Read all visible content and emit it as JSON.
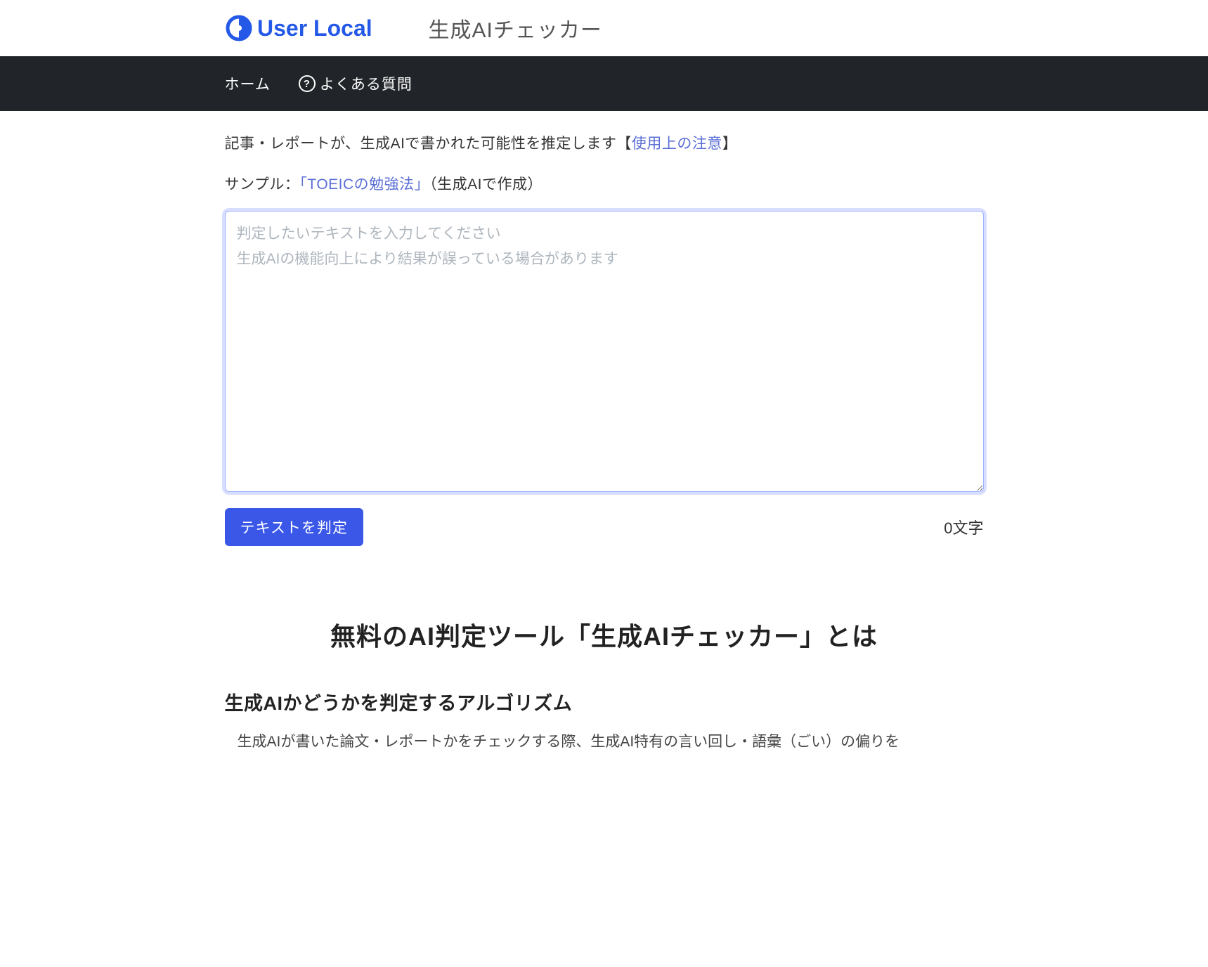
{
  "header": {
    "logo_text": "User Local",
    "app_title": "生成AIチェッカー"
  },
  "nav": {
    "home": "ホーム",
    "faq": "よくある質問"
  },
  "intro": {
    "prefix": "記事・レポートが、生成AIで書かれた可能性を推定します【",
    "notice_link": "使用上の注意",
    "suffix": "】"
  },
  "sample": {
    "label": "サンプル：",
    "link": "「TOEICの勉強法」",
    "note": "（生成AIで作成）"
  },
  "input": {
    "placeholder": "判定したいテキストを入力してください\n生成AIの機能向上により結果が誤っている場合があります",
    "value": ""
  },
  "actions": {
    "submit_label": "テキストを判定",
    "char_count": "0文字"
  },
  "section": {
    "heading": "無料のAI判定ツール「生成AIチェッカー」とは",
    "sub_heading": "生成AIかどうかを判定するアルゴリズム",
    "body": "生成AIが書いた論文・レポートかをチェックする際、生成AI特有の言い回し・語彙（ごい）の偏りを"
  }
}
